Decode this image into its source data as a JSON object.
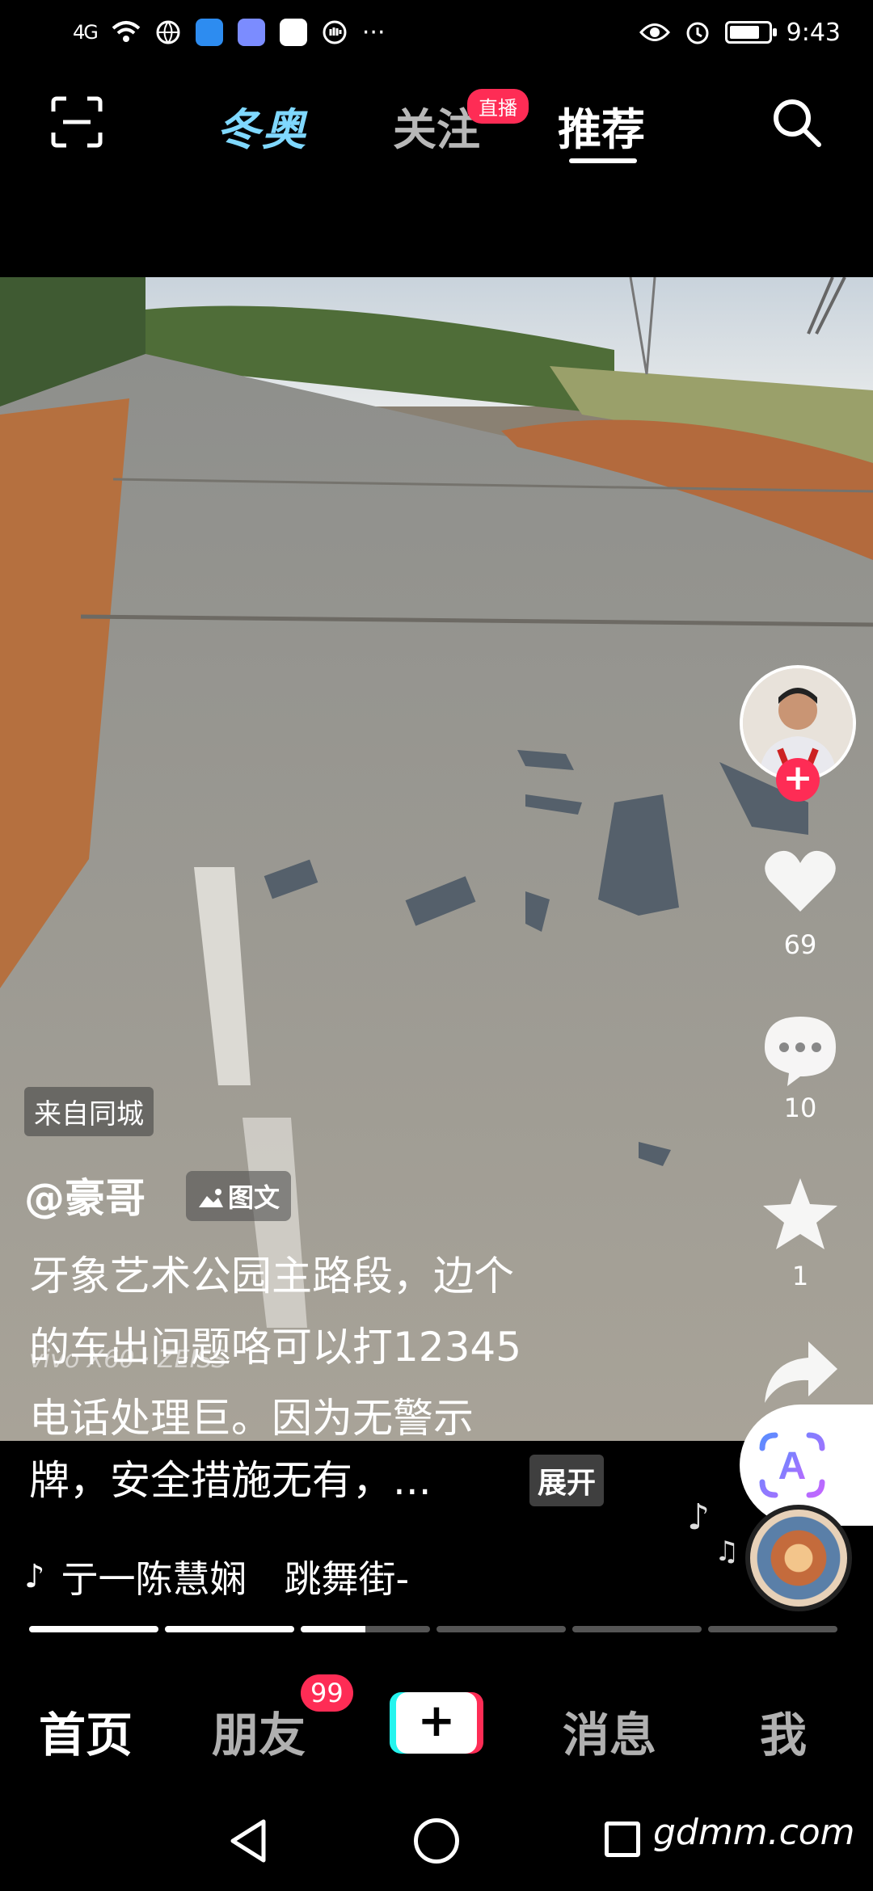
{
  "status_bar": {
    "network": "4G",
    "time": "9:43",
    "more": "···"
  },
  "top_nav": {
    "tab_winter": "冬奥",
    "tab_follow": "关注",
    "live_badge": "直播",
    "tab_recommend": "推荐"
  },
  "post": {
    "location": "来自同城",
    "author": "@豪哥",
    "type_label": "图文",
    "caption_line1": "牙象艺术公园主路段，边个",
    "caption_line2": "的车出问题咯可以打12345",
    "caption_line3": "电话处理巨。因为无警示",
    "caption_line4": "牌，安全措施无有，...",
    "expand": "展开",
    "camera_watermark": "vivo X60 · ZEISS",
    "music": "亍一陈慧娴　跳舞街-"
  },
  "rail": {
    "likes": "69",
    "comments": "10",
    "favorites": "1",
    "ai_label": "A"
  },
  "progress": {
    "segments": [
      1,
      1,
      0.5,
      0,
      0,
      0
    ]
  },
  "bottom_nav": {
    "home": "首页",
    "friends": "朋友",
    "friends_badge": "99",
    "create": "+",
    "messages": "消息",
    "me": "我"
  },
  "system": {
    "site_mark": "gdmm.com"
  },
  "colors": {
    "accent": "#fe2c55",
    "cyan": "#25f4ee"
  }
}
